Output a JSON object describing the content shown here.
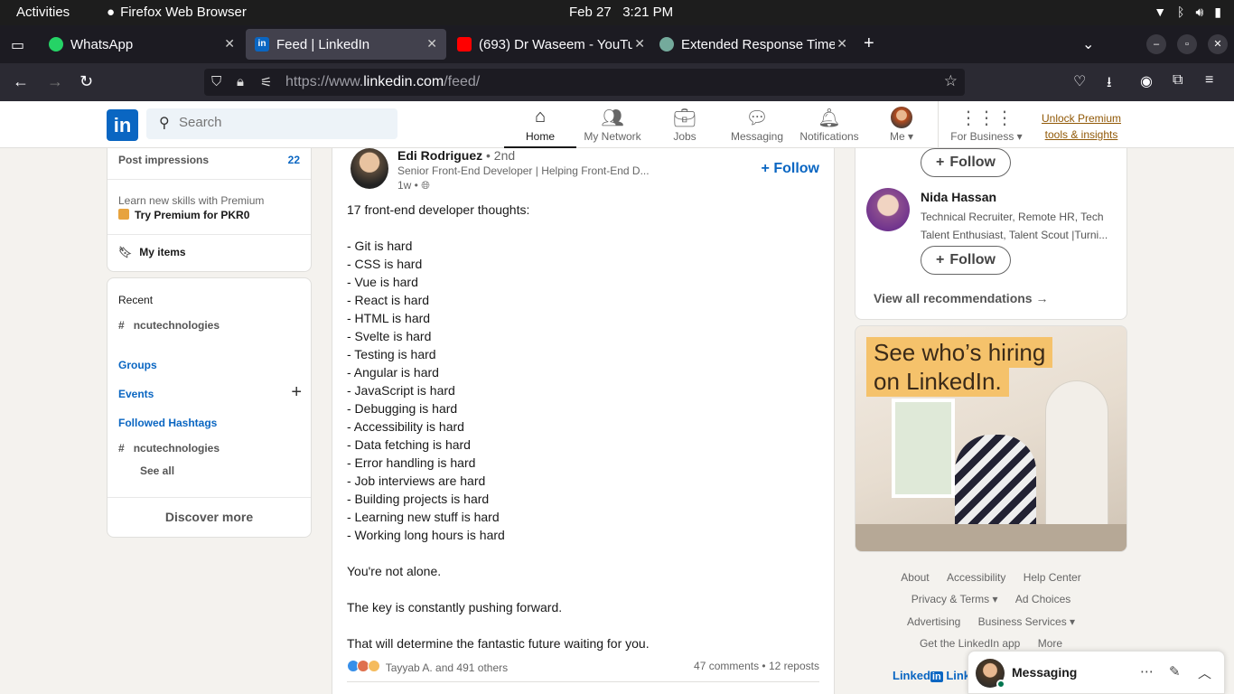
{
  "system_bar": {
    "activities": "Activities",
    "app_name": "Firefox Web Browser",
    "date": "Feb 27",
    "time": "3:21 PM"
  },
  "browser": {
    "tabs": [
      {
        "title": "WhatsApp",
        "icon": "whatsapp-icon",
        "color": "#25d366",
        "active": false
      },
      {
        "title": "Feed | LinkedIn",
        "icon": "linkedin-icon",
        "color": "#0a66c2",
        "active": true
      },
      {
        "title": "(693) Dr Waseem - YouTu",
        "icon": "youtube-icon",
        "color": "#ff0000",
        "active": false
      },
      {
        "title": "Extended Response Time",
        "icon": "chatgpt-icon",
        "color": "#74aa9c",
        "active": false
      }
    ],
    "url_prefix": "https://www.",
    "url_domain": "linkedin.com",
    "url_path": "/feed/"
  },
  "linkedin": {
    "search_placeholder": "Search",
    "nav": [
      {
        "label": "Home",
        "icon": "home-icon",
        "active": true
      },
      {
        "label": "My Network",
        "icon": "network-icon",
        "active": false
      },
      {
        "label": "Jobs",
        "icon": "briefcase-icon",
        "active": false
      },
      {
        "label": "Messaging",
        "icon": "chat-icon",
        "active": false
      },
      {
        "label": "Notifications",
        "icon": "bell-icon",
        "active": false
      },
      {
        "label": "Me",
        "icon": "profile-avatar-icon",
        "active": false
      },
      {
        "label": "For Business",
        "icon": "grid-icon",
        "active": false
      }
    ],
    "premium_line1": "Unlock Premium",
    "premium_line2": "tools & insights"
  },
  "left_rail": {
    "post_impressions_label": "Post impressions",
    "post_impressions_value": "22",
    "premium_prompt": "Learn new skills with Premium",
    "premium_cta": "Try Premium for PKR0",
    "my_items": "My items",
    "recent": "Recent",
    "recent_item": "ncutechnologies",
    "groups": "Groups",
    "events": "Events",
    "followed_hashtags": "Followed Hashtags",
    "hashtag_item": "ncutechnologies",
    "see_all": "See all",
    "discover_more": "Discover more"
  },
  "post": {
    "author": "Edi Rodriguez",
    "degree": "• 2nd",
    "headline": "Senior Front-End Developer | Helping Front-End D...",
    "time": "1w •",
    "follow": "Follow",
    "lines": [
      "17 front-end developer thoughts:",
      "",
      "- Git is hard",
      "- CSS is hard",
      "- Vue is hard",
      "- React is hard",
      "- HTML is hard",
      "- Svelte is hard",
      "- Testing is hard",
      "- Angular is hard",
      "- JavaScript is hard",
      "- Debugging is hard",
      "- Accessibility is hard",
      "- Data fetching is hard",
      "- Error handling is hard",
      "- Job interviews are hard",
      "- Building projects is hard",
      "- Learning new stuff is hard",
      "- Working long hours is hard",
      "",
      "You're not alone.",
      "",
      "The key is constantly pushing forward.",
      "",
      "That will determine the fantastic future waiting for you."
    ],
    "reactions_text": "Tayyab A. and 491 others",
    "comments": "47 comments",
    "reposts": "12 reposts"
  },
  "right_rail": {
    "follow_label": "Follow",
    "rec_name": "Nida Hassan",
    "rec_desc": "Technical Recruiter, Remote HR, Tech Talent Enthusiast, Talent Scout |Turni...",
    "view_all": "View all recommendations →",
    "ad_line1": "See who’s hiring",
    "ad_line2": "on LinkedIn."
  },
  "footer": {
    "links": [
      "About",
      "Accessibility",
      "Help Center",
      "Privacy & Terms ▾",
      "Ad Choices",
      "Advertising",
      "Business Services ▾",
      "Get the LinkedIn app",
      "More"
    ],
    "brand": "Linked",
    "brand_in": "in",
    "brand_tail": "Link"
  },
  "messaging": {
    "title": "Messaging"
  }
}
